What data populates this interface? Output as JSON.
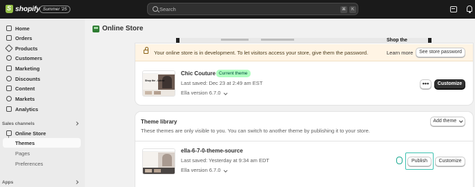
{
  "topbar": {
    "brand": "shopify",
    "edition": "Summer '25",
    "search_placeholder": "Search",
    "shortcut_keys": [
      "⌘",
      "K"
    ]
  },
  "sidebar": {
    "items": [
      {
        "label": "Home",
        "icon": "home-icon"
      },
      {
        "label": "Orders",
        "icon": "orders-icon"
      },
      {
        "label": "Products",
        "icon": "products-icon"
      },
      {
        "label": "Customers",
        "icon": "customers-icon"
      },
      {
        "label": "Marketing",
        "icon": "marketing-icon"
      },
      {
        "label": "Discounts",
        "icon": "discounts-icon"
      },
      {
        "label": "Content",
        "icon": "content-icon"
      },
      {
        "label": "Markets",
        "icon": "markets-icon"
      },
      {
        "label": "Analytics",
        "icon": "analytics-icon"
      }
    ],
    "sales_channels_label": "Sales channels",
    "online_store": {
      "label": "Online Store",
      "sub_items": [
        "Themes",
        "Pages",
        "Preferences"
      ]
    },
    "apps_label": "Apps"
  },
  "page": {
    "title": "Online Store"
  },
  "preview": {
    "shop_text": "Shop the"
  },
  "banner": {
    "message": "Your online store is in development. To let visitors access your store, give them the password.",
    "learn_more": "Learn more",
    "button": "See store password"
  },
  "current_theme": {
    "name": "Chic Couture",
    "badge": "Current theme",
    "last_saved": "Last saved: Dec 23 at 2:49 am EST",
    "version": "Ella version 6.7.0",
    "more_label": "•••",
    "customize_label": "Customize",
    "thumb_text": "Shop the - Latest"
  },
  "library": {
    "title": "Theme library",
    "description": "These themes are only visible to you. You can switch to another theme by publishing it to your store.",
    "add_theme_label": "Add theme",
    "theme": {
      "name": "ella-6-7-0-theme-source",
      "last_saved": "Last saved: Yesterday at 9:34 am EDT",
      "version": "Ella version 6.7.0",
      "publish_label": "Publish",
      "customize_label": "Customize"
    }
  }
}
